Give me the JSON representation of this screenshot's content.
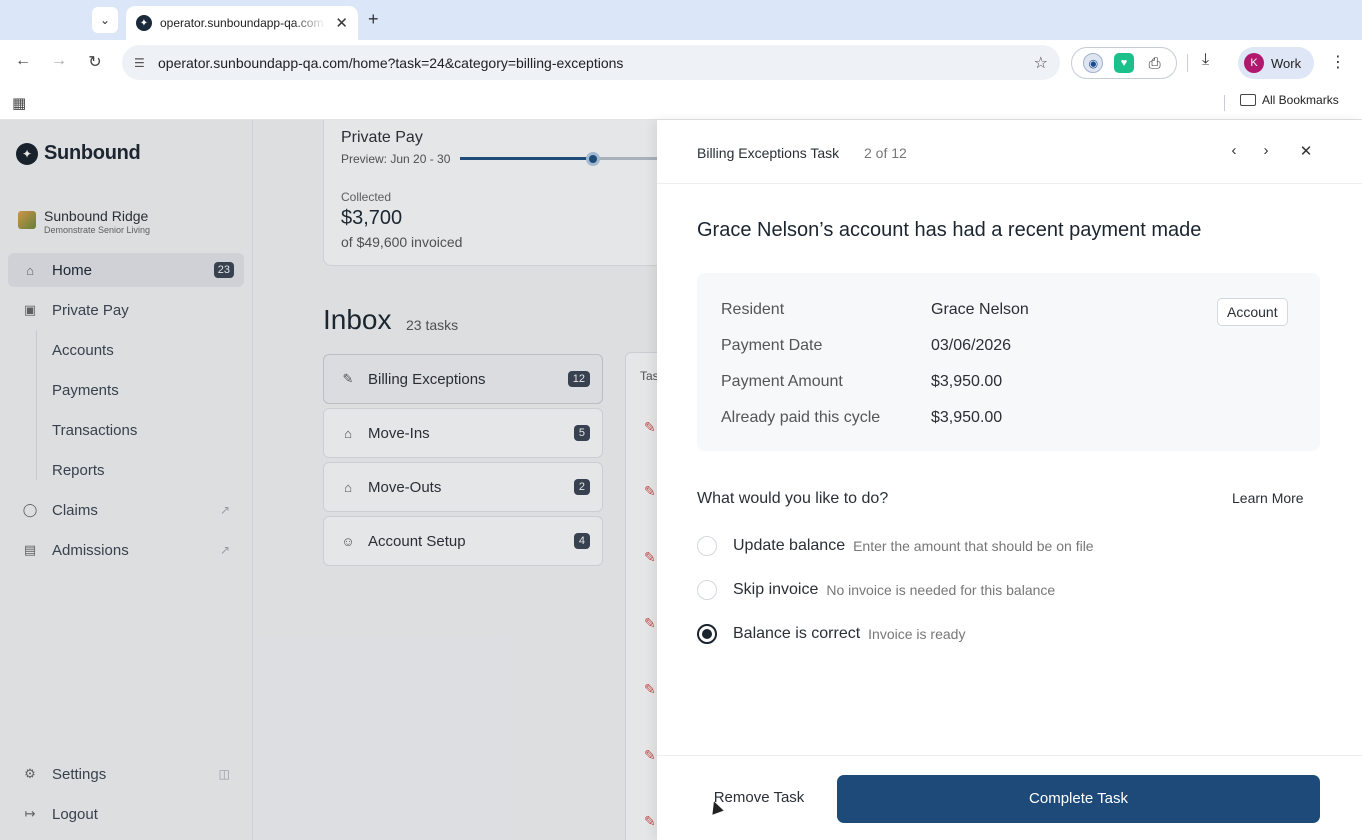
{
  "browser": {
    "tab_title": "operator.sunboundapp-qa.com",
    "url": "operator.sunboundapp-qa.com/home?task=24&category=billing-exceptions",
    "profile_initial": "K",
    "profile_label": "Work",
    "all_bookmarks": "All Bookmarks"
  },
  "sidebar": {
    "brand": "Sunbound",
    "org_name": "Sunbound Ridge",
    "org_sub": "Demonstrate Senior Living",
    "home": "Home",
    "home_badge": "23",
    "private_pay": "Private Pay",
    "accounts": "Accounts",
    "payments": "Payments",
    "transactions": "Transactions",
    "reports": "Reports",
    "claims": "Claims",
    "admissions": "Admissions",
    "settings": "Settings",
    "logout": "Logout"
  },
  "main": {
    "private_pay_title": "Private Pay",
    "preview_label": "Preview: Jun 20 - 30",
    "slider_position": 0.58,
    "collected_label": "Collected",
    "collected_amount": "$3,700",
    "invoiced_label": "of $49,600 invoiced",
    "inbox_title": "Inbox",
    "inbox_count": "23 tasks",
    "categories": [
      {
        "label": "Billing Exceptions",
        "count": "12"
      },
      {
        "label": "Move-Ins",
        "count": "5"
      },
      {
        "label": "Move-Outs",
        "count": "2"
      },
      {
        "label": "Account Setup",
        "count": "4"
      }
    ],
    "task_col_head": "Tas"
  },
  "drawer": {
    "title": "Billing Exceptions Task",
    "position": "2 of 12",
    "heading": "Grace Nelson’s account has had a recent payment made",
    "account_button": "Account",
    "rows": [
      {
        "label": "Resident",
        "value": "Grace Nelson"
      },
      {
        "label": "Payment Date",
        "value": "03/06/2026"
      },
      {
        "label": "Payment Amount",
        "value": "$3,950.00"
      },
      {
        "label": "Already paid this cycle",
        "value": "$3,950.00"
      }
    ],
    "question": "What would you like to do?",
    "learn_more": "Learn More",
    "options": [
      {
        "label": "Update balance",
        "desc": "Enter the amount that should be on file",
        "checked": false
      },
      {
        "label": "Skip invoice",
        "desc": "No invoice is needed for this balance",
        "checked": false
      },
      {
        "label": "Balance is correct",
        "desc": "Invoice is ready",
        "checked": true
      }
    ],
    "remove_task": "Remove Task",
    "complete_task": "Complete Task"
  }
}
